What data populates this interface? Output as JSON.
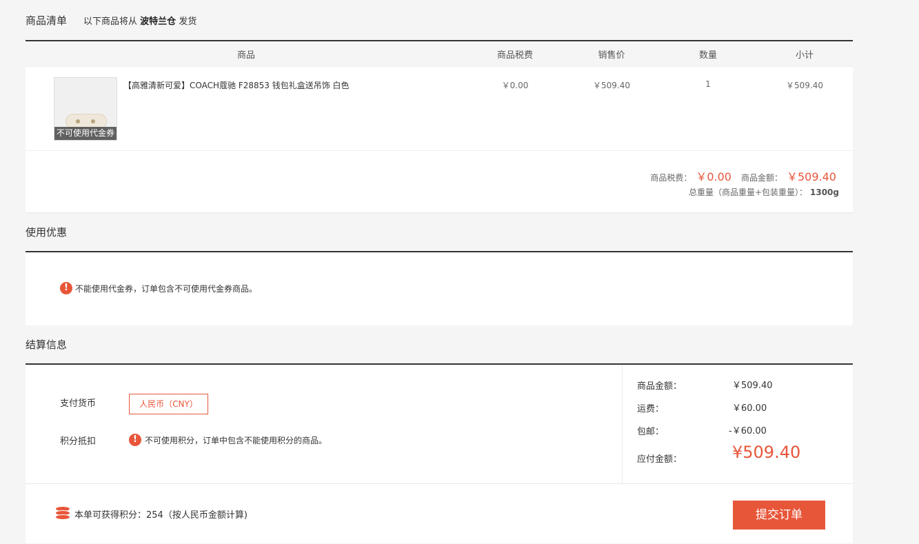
{
  "goods_section": {
    "title": "商品清单",
    "subtitle_prefix": "以下商品将从",
    "warehouse": "波特兰仓",
    "subtitle_suffix": "发货"
  },
  "table": {
    "headers": [
      "商品",
      "商品税费",
      "销售价",
      "数量",
      "小计"
    ],
    "rows": [
      {
        "name": "【高雅清新可爱】COACH蔻驰 F28853 钱包礼盒送吊饰 白色",
        "tag": "不可使用代金券",
        "tax": "￥0.00",
        "price": "￥509.40",
        "qty": "1",
        "subtotal": "￥509.40"
      }
    ]
  },
  "summary": {
    "tax_label": "商品税费：",
    "tax_value": "￥0.00",
    "amount_label": "商品金额：",
    "amount_value": "￥509.40",
    "weight_label": "总重量（商品重量+包装重量）：",
    "weight_value": "1300g"
  },
  "promo_section": {
    "title": "使用优惠",
    "message": "不能使用代金券，订单包含不可使用代金券商品。"
  },
  "settle_section": {
    "title": "结算信息",
    "currency_label": "支付货币",
    "currency_value": "人民币（CNY）",
    "points_label": "积分抵扣",
    "points_message": "不可使用积分，订单中包含不能使用积分的商品。",
    "goods_amount_label": "商品金额：",
    "goods_amount_value": "￥509.40",
    "shipping_label": "运费：",
    "shipping_value": "￥60.00",
    "free_shipping_label": "包邮：",
    "free_shipping_value": "-￥60.00",
    "payable_label": "应付金额：",
    "payable_value": "¥509.40"
  },
  "footer": {
    "points_earn": "本单可获得积分：254（按人民币金额计算)",
    "submit_label": "提交订单"
  },
  "colors": {
    "accent": "#e8563a"
  },
  "icons": {
    "alert": "exclamation-circle-icon",
    "coins": "coin-stack-icon"
  }
}
